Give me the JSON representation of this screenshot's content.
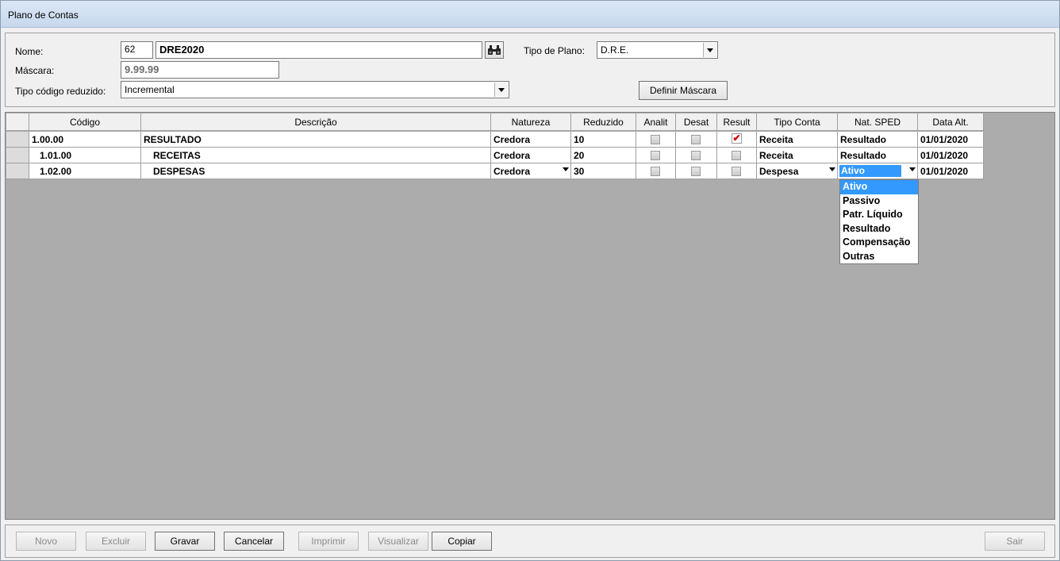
{
  "window": {
    "title": "Plano de Contas"
  },
  "form": {
    "nome_label": "Nome:",
    "nome_id": "62",
    "nome_value": "DRE2020",
    "tipo_plano_label": "Tipo de Plano:",
    "tipo_plano_value": "D.R.E.",
    "mascara_label": "Máscara:",
    "mascara_value": "9.99.99",
    "tipo_codigo_label": "Tipo código reduzido:",
    "tipo_codigo_value": "Incremental",
    "definir_mascara_label": "Definir Máscara"
  },
  "grid": {
    "columns": [
      "Código",
      "Descrição",
      "Natureza",
      "Reduzido",
      "Analit",
      "Desat",
      "Result",
      "Tipo Conta",
      "Nat. SPED",
      "Data Alt."
    ],
    "rows": [
      {
        "codigo": "1.00.00",
        "descricao": "RESULTADO",
        "natureza": "Credora",
        "reduzido": "10",
        "analit": false,
        "desat": false,
        "result": true,
        "tipo_conta": "Receita",
        "nat_sped": "Resultado",
        "data_alt": "01/01/2020"
      },
      {
        "codigo": "1.01.00",
        "descricao": "RECEITAS",
        "natureza": "Credora",
        "reduzido": "20",
        "analit": false,
        "desat": false,
        "result": false,
        "tipo_conta": "Receita",
        "nat_sped": "Resultado",
        "data_alt": "01/01/2020"
      },
      {
        "codigo": "1.02.00",
        "descricao": "DESPESAS",
        "natureza": "Credora",
        "reduzido": "30",
        "analit": false,
        "desat": false,
        "result": false,
        "tipo_conta": "Despesa",
        "nat_sped": "Ativo",
        "data_alt": "01/01/2020"
      }
    ],
    "checked_mark": "✔",
    "nat_sped_options": [
      "Ativo",
      "Passivo",
      "Patr. Líquido",
      "Resultado",
      "Compensação",
      "Outras"
    ],
    "nat_sped_selected": "Ativo"
  },
  "buttons": {
    "novo": "Novo",
    "excluir": "Excluir",
    "gravar": "Gravar",
    "cancelar": "Cancelar",
    "imprimir": "Imprimir",
    "visualizar": "Visualizar",
    "copiar": "Copiar",
    "sair": "Sair"
  },
  "colors": {
    "selection": "#3399ff",
    "grid_background": "#acacac",
    "check_red": "#d00000"
  }
}
